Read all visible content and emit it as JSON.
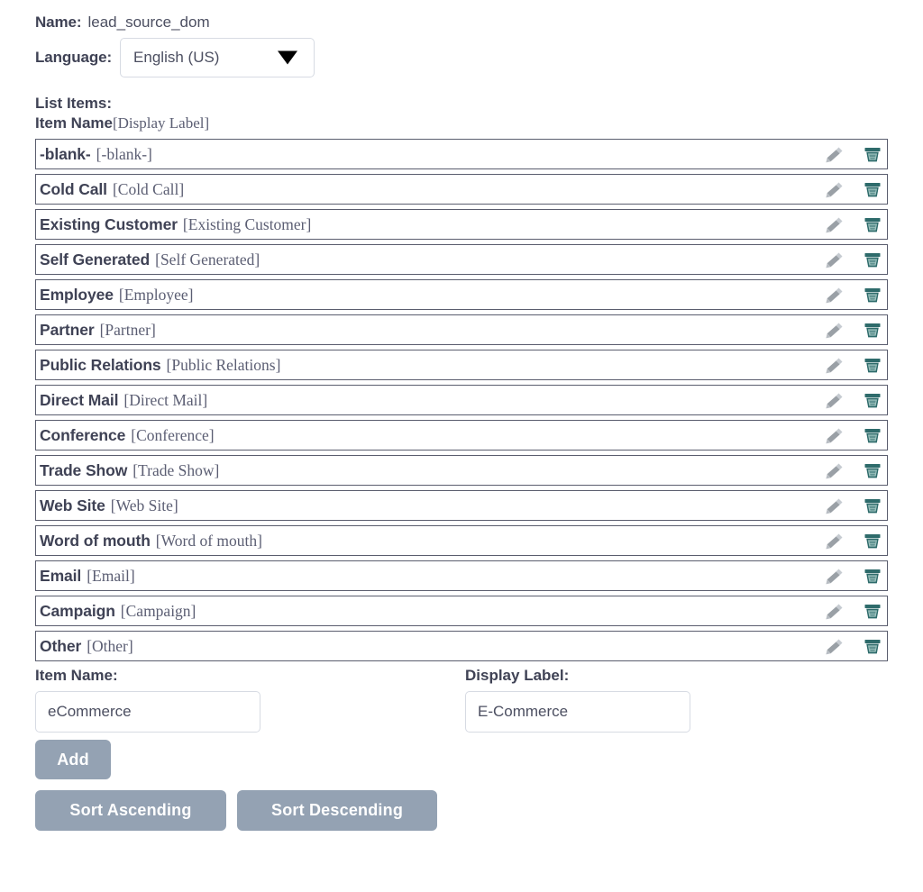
{
  "header": {
    "name_label": "Name:",
    "name_value": "lead_source_dom",
    "language_label": "Language:",
    "language_value": "English (US)",
    "caret_icon": "chevron-down-icon"
  },
  "list_section": {
    "title": "List Items:",
    "column_header_name": "Item Name",
    "column_header_label": "[Display Label]",
    "edit_icon": "pencil-icon",
    "delete_icon": "trash-icon",
    "items": [
      {
        "name": "-blank-",
        "label": "[-blank-]"
      },
      {
        "name": "Cold Call",
        "label": "[Cold Call]"
      },
      {
        "name": "Existing Customer",
        "label": "[Existing Customer]"
      },
      {
        "name": "Self Generated",
        "label": "[Self Generated]"
      },
      {
        "name": "Employee",
        "label": "[Employee]"
      },
      {
        "name": "Partner",
        "label": "[Partner]"
      },
      {
        "name": "Public Relations",
        "label": "[Public Relations]"
      },
      {
        "name": "Direct Mail",
        "label": "[Direct Mail]"
      },
      {
        "name": "Conference",
        "label": "[Conference]"
      },
      {
        "name": "Trade Show",
        "label": "[Trade Show]"
      },
      {
        "name": "Web Site",
        "label": "[Web Site]"
      },
      {
        "name": "Word of mouth",
        "label": "[Word of mouth]"
      },
      {
        "name": "Email",
        "label": "[Email]"
      },
      {
        "name": "Campaign",
        "label": "[Campaign]"
      },
      {
        "name": "Other",
        "label": "[Other]"
      }
    ]
  },
  "form": {
    "item_name_label": "Item Name:",
    "item_name_value": "eCommerce",
    "display_label_label": "Display Label:",
    "display_label_value": "E-Commerce",
    "add_button": "Add",
    "sort_ascending_button": "Sort Ascending",
    "sort_descending_button": "Sort Descending"
  },
  "colors": {
    "text": "#3f4255",
    "serif_text": "#5b5e73",
    "row_border": "#5a5d6e",
    "button_bg": "#94a2b3",
    "input_border": "#d7dbe3",
    "trash_icon": "#2e6b6b",
    "pencil_icon": "#9aa0a6"
  }
}
